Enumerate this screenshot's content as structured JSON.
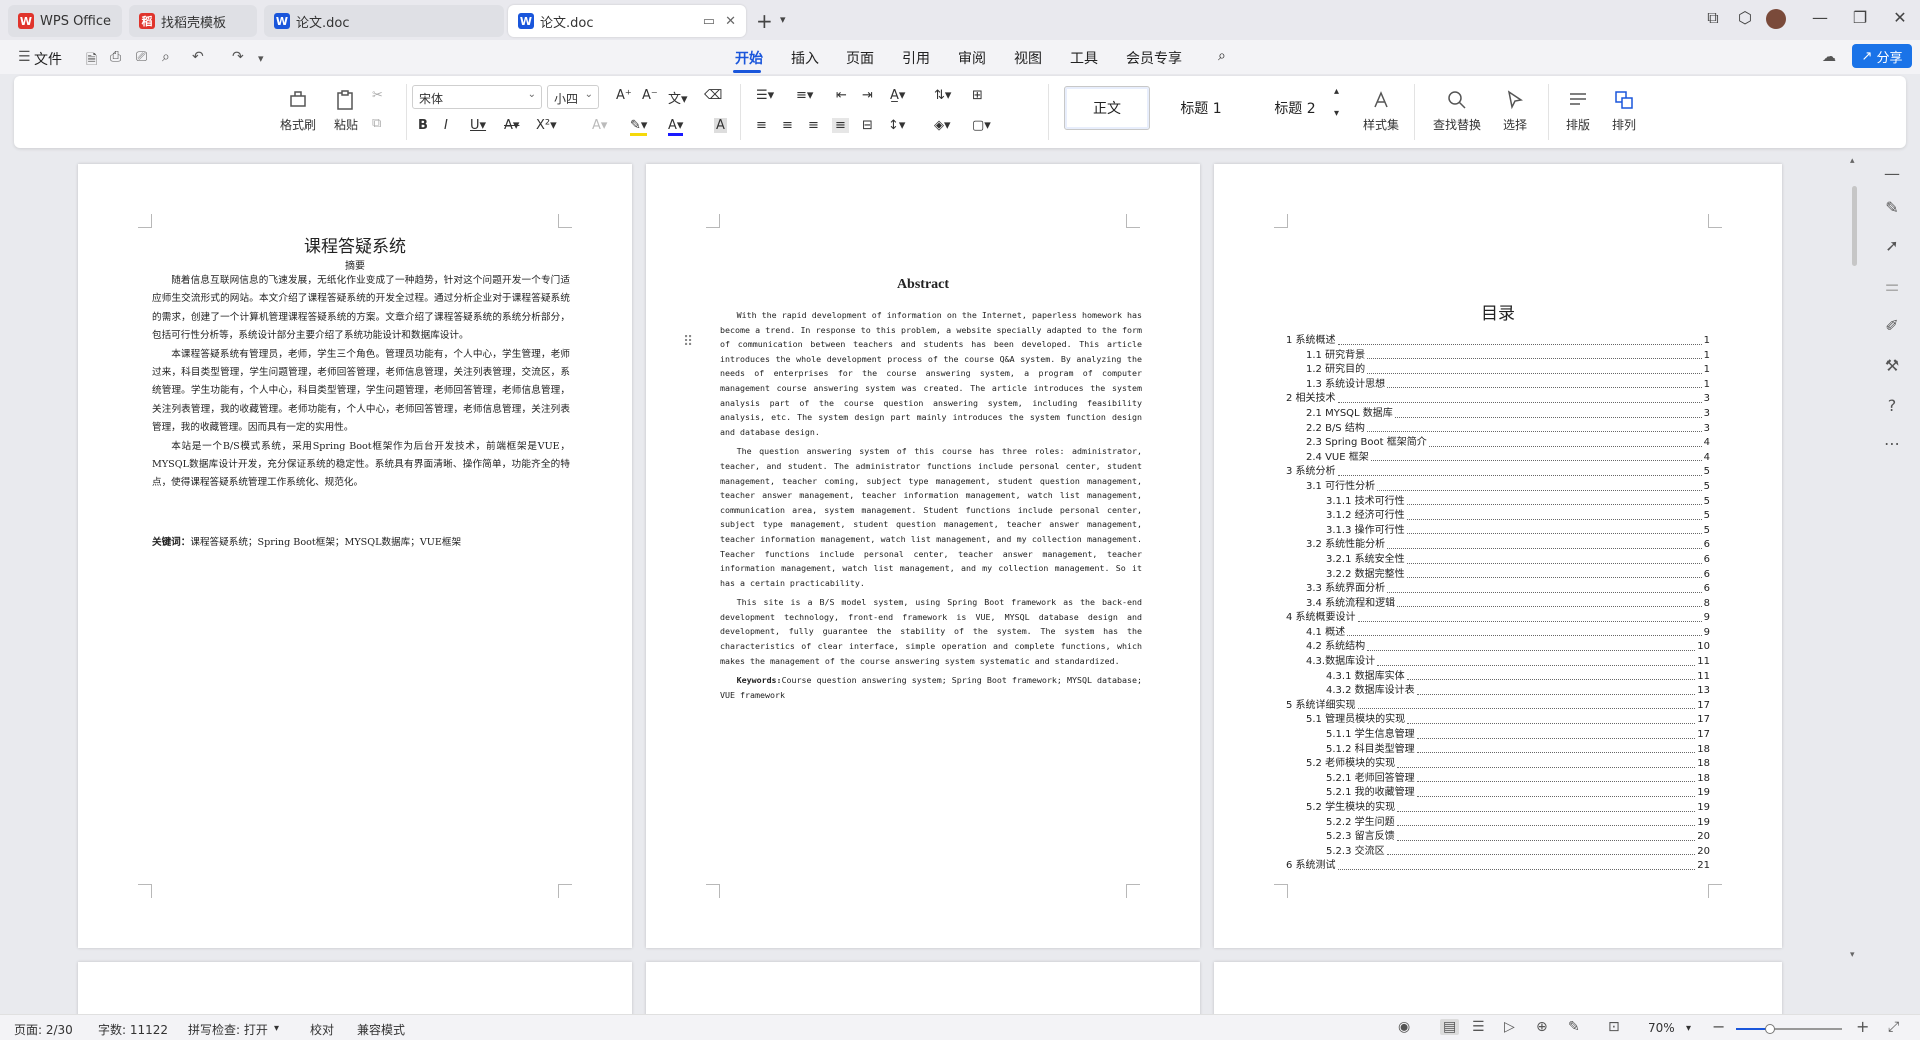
{
  "tabs": [
    {
      "label": "WPS Office",
      "logo": "W",
      "color": "#e0342c"
    },
    {
      "label": "找稻壳模板",
      "logo": "稻",
      "color": "#e0342c"
    },
    {
      "label": "论文.doc",
      "logo": "W",
      "color": "#1a56db"
    },
    {
      "label": "论文.doc",
      "logo": "W",
      "color": "#1a56db"
    }
  ],
  "menu": {
    "file": "文件",
    "items": [
      "开始",
      "插入",
      "页面",
      "引用",
      "审阅",
      "视图",
      "工具",
      "会员专享"
    ],
    "active": "开始",
    "share": "分享"
  },
  "ribbon": {
    "format_painter": "格式刷",
    "paste": "粘贴",
    "font_name": "宋体",
    "font_size": "小四",
    "style_normal": "正文",
    "style_h1": "标题 1",
    "style_h2": "标题 2",
    "styles_set": "样式集",
    "find_replace": "查找替换",
    "select": "选择",
    "layout": "排版",
    "arrange": "排列"
  },
  "page1": {
    "title": "课程答疑系统",
    "subtitle": "摘要",
    "paragraphs": [
      "随着信息互联网信息的飞速发展，无纸化作业变成了一种趋势，针对这个问题开发一个专门适应师生交流形式的网站。本文介绍了课程答疑系统的开发全过程。通过分析企业对于课程答疑系统的需求，创建了一个计算机管理课程答疑系统的方案。文章介绍了课程答疑系统的系统分析部分，包括可行性分析等，系统设计部分主要介绍了系统功能设计和数据库设计。",
      "本课程答疑系统有管理员，老师，学生三个角色。管理员功能有，个人中心，学生管理，老师过来，科目类型管理，学生问题管理，老师回答管理，老师信息管理，关注列表管理，交流区，系统管理。学生功能有，个人中心，科目类型管理，学生问题管理，老师回答管理，老师信息管理，关注列表管理，我的收藏管理。老师功能有，个人中心，老师回答管理，老师信息管理，关注列表管理，我的收藏管理。因而具有一定的实用性。",
      "本站是一个B/S模式系统，采用Spring Boot框架作为后台开发技术，前端框架是VUE，MYSQL数据库设计开发，充分保证系统的稳定性。系统具有界面清晰、操作简单，功能齐全的特点，使得课程答疑系统管理工作系统化、规范化。"
    ],
    "keywords_label": "关键词：",
    "keywords": "课程答疑系统；Spring Boot框架；MYSQL数据库；VUE框架"
  },
  "page2": {
    "title": "Abstract",
    "paragraphs": [
      "With the rapid development of information on the Internet, paperless homework has become a trend. In response to this problem, a website specially adapted to the form of communication between teachers and students has been developed. This article introduces the whole development process of the course Q&A system. By analyzing the needs of enterprises for the course answering system, a program of computer management course answering system was created. The article introduces the system analysis part of the course question answering system, including feasibility analysis, etc. The system design part mainly introduces the system function design and database design.",
      "The question answering system of this course has three roles: administrator, teacher, and student. The administrator functions include personal center, student management, teacher coming, subject type management, student question management, teacher answer management, teacher information management, watch list management, communication area, system management. Student functions include personal center, subject type management, student question management, teacher answer management, teacher information management, watch list management, and my collection management. Teacher functions include personal center, teacher answer management, teacher information management, watch list management, and my collection management. So it has a certain practicability.",
      "This site is a B/S model system, using Spring Boot framework as the back-end development technology, front-end framework is VUE, MYSQL database design and development, fully guarantee the stability of the system. The system has the characteristics of clear interface, simple operation and complete functions, which makes the management of the course answering system systematic and standardized."
    ],
    "keywords_label": "Keywords:",
    "keywords": "Course question answering system; Spring Boot framework; MYSQL database; VUE framework"
  },
  "page3": {
    "title": "目录",
    "toc": [
      {
        "label": "1 系统概述",
        "page": "1",
        "level": 1
      },
      {
        "label": "1.1 研究背景",
        "page": "1",
        "level": 2
      },
      {
        "label": "1.2 研究目的",
        "page": "1",
        "level": 2
      },
      {
        "label": "1.3 系统设计思想",
        "page": "1",
        "level": 2
      },
      {
        "label": "2 相关技术",
        "page": "3",
        "level": 1
      },
      {
        "label": "2.1 MYSQL 数据库",
        "page": "3",
        "level": 2
      },
      {
        "label": "2.2 B/S 结构",
        "page": "3",
        "level": 2
      },
      {
        "label": "2.3 Spring Boot 框架简介",
        "page": "4",
        "level": 2
      },
      {
        "label": "2.4 VUE 框架",
        "page": "4",
        "level": 2
      },
      {
        "label": "3 系统分析",
        "page": "5",
        "level": 1
      },
      {
        "label": "3.1 可行性分析",
        "page": "5",
        "level": 2
      },
      {
        "label": "3.1.1 技术可行性",
        "page": "5",
        "level": 3
      },
      {
        "label": "3.1.2 经济可行性",
        "page": "5",
        "level": 3
      },
      {
        "label": "3.1.3 操作可行性",
        "page": "5",
        "level": 3
      },
      {
        "label": "3.2 系统性能分析",
        "page": "6",
        "level": 2
      },
      {
        "label": "3.2.1 系统安全性",
        "page": "6",
        "level": 3
      },
      {
        "label": "3.2.2 数据完整性",
        "page": "6",
        "level": 3
      },
      {
        "label": "3.3 系统界面分析",
        "page": "6",
        "level": 2
      },
      {
        "label": "3.4 系统流程和逻辑",
        "page": "8",
        "level": 2
      },
      {
        "label": "4 系统概要设计",
        "page": "9",
        "level": 1
      },
      {
        "label": "4.1 概述",
        "page": "9",
        "level": 2
      },
      {
        "label": "4.2 系统结构",
        "page": "10",
        "level": 2
      },
      {
        "label": "4.3.数据库设计",
        "page": "11",
        "level": 2
      },
      {
        "label": "4.3.1 数据库实体",
        "page": "11",
        "level": 3
      },
      {
        "label": "4.3.2 数据库设计表",
        "page": "13",
        "level": 3
      },
      {
        "label": "5 系统详细实现",
        "page": "17",
        "level": 1
      },
      {
        "label": "5.1 管理员模块的实现",
        "page": "17",
        "level": 2
      },
      {
        "label": "5.1.1 学生信息管理",
        "page": "17",
        "level": 3
      },
      {
        "label": "5.1.2 科目类型管理",
        "page": "18",
        "level": 3
      },
      {
        "label": "5.2 老师模块的实现",
        "page": "18",
        "level": 2
      },
      {
        "label": "5.2.1 老师回答管理",
        "page": "18",
        "level": 3
      },
      {
        "label": "5.2.1 我的收藏管理",
        "page": "19",
        "level": 3
      },
      {
        "label": "5.2 学生模块的实现",
        "page": "19",
        "level": 2
      },
      {
        "label": "5.2.2 学生问题",
        "page": "19",
        "level": 3
      },
      {
        "label": "5.2.3 留言反馈",
        "page": "20",
        "level": 3
      },
      {
        "label": "5.2.3 交流区",
        "page": "20",
        "level": 3
      },
      {
        "label": "6 系统测试",
        "page": "21",
        "level": 1
      }
    ]
  },
  "status": {
    "page": "页面: 2/30",
    "words": "字数: 11122",
    "spell": "拼写检查: 打开",
    "proof": "校对",
    "compat": "兼容模式",
    "zoom": "70%",
    "zoom_fraction": 0.32
  },
  "colors": {
    "accent": "#1a56db"
  }
}
